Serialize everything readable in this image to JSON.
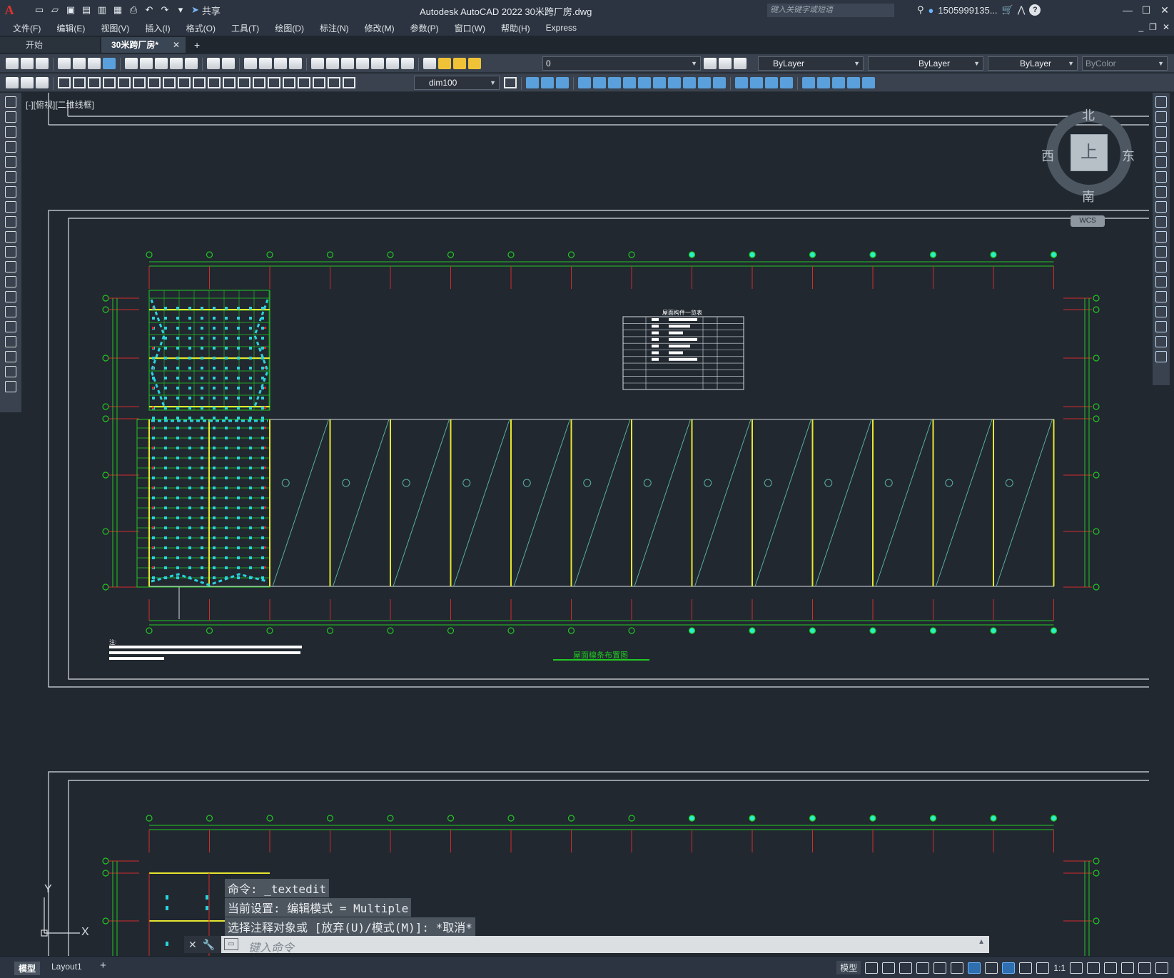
{
  "app": {
    "logo": "A",
    "title": "Autodesk AutoCAD 2022    30米跨厂房.dwg",
    "share_label": "共享",
    "search_placeholder": "键入关键字或短语",
    "user": "1505999135...",
    "help": "?"
  },
  "menu": [
    "文件(F)",
    "编辑(E)",
    "视图(V)",
    "插入(I)",
    "格式(O)",
    "工具(T)",
    "绘图(D)",
    "标注(N)",
    "修改(M)",
    "参数(P)",
    "窗口(W)",
    "帮助(H)",
    "Express"
  ],
  "tabs": {
    "start": "开始",
    "active": "30米跨厂房*",
    "close": "✕",
    "add": "+"
  },
  "toolbar": {
    "layer_value": "0",
    "color_value": "ByLayer",
    "linetype_value": "ByLayer",
    "lineweight_value": "ByLayer",
    "plotstyle_value": "ByColor",
    "dimstyle_value": "dim100"
  },
  "viewport": {
    "label": "[-][俯视][二维线框]",
    "compass": {
      "north": "北",
      "south": "南",
      "west": "西",
      "east": "东",
      "top": "上",
      "wcs": "WCS"
    }
  },
  "drawing": {
    "table_title": "屋面构件一览表",
    "plan_title": "屋面檩条布置图",
    "note_label": "注:",
    "ucs_x": "X",
    "ucs_y": "Y"
  },
  "command": {
    "history": [
      "命令: _textedit",
      "当前设置: 编辑模式 = Multiple",
      "选择注释对象或 [放弃(U)/模式(M)]: *取消*"
    ],
    "placeholder": "键入命令"
  },
  "status": {
    "model_tab": "模型",
    "layout_tab": "Layout1",
    "add": "+",
    "model_btn": "模型",
    "scale": "1:1"
  },
  "colors": {
    "background": "#212830",
    "grid_green": "#22c722",
    "axis_red": "#d22b2b",
    "column_yellow": "#e6e62e",
    "brace_cyan": "#2ad3dd",
    "frame_white": "#d9dde2"
  }
}
